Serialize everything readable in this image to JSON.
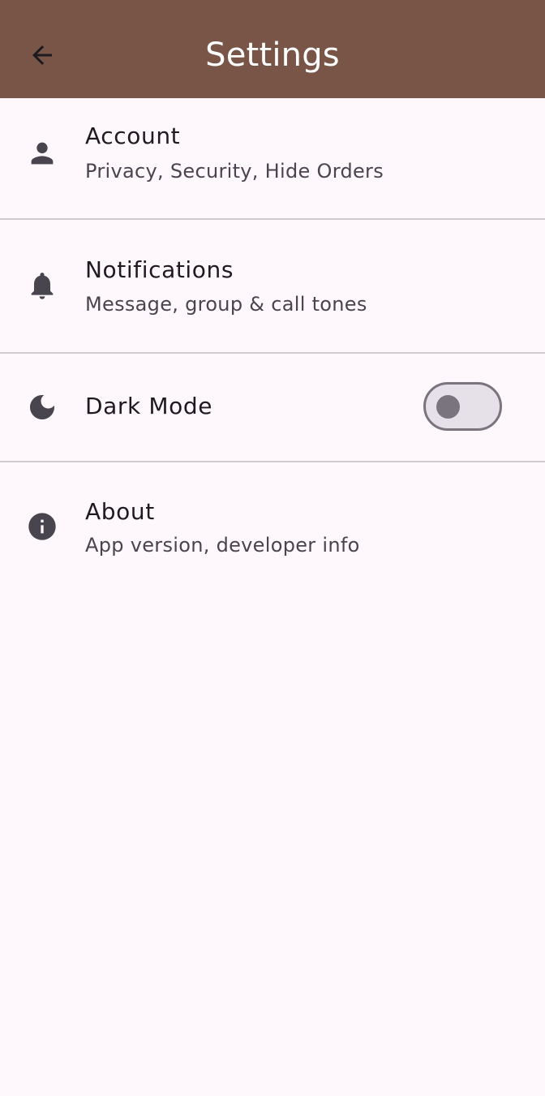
{
  "app_bar": {
    "title": "Settings",
    "background_color": "#795548",
    "back_icon": "arrow-left-icon"
  },
  "settings": {
    "account": {
      "icon": "person-icon",
      "title": "Account",
      "subtitle": "Privacy, Security, Hide Orders"
    },
    "notifications": {
      "icon": "bell-icon",
      "title": "Notifications",
      "subtitle": "Message, group & call tones"
    },
    "dark_mode": {
      "icon": "moon-icon",
      "title": "Dark Mode",
      "toggle_state": "off"
    },
    "about": {
      "icon": "info-icon",
      "title": "About",
      "subtitle": "App version, developer info"
    }
  },
  "colors": {
    "background": "#FEF7FC",
    "divider": "#CFCBD0",
    "icon": "#49454F",
    "toggle_track": "#E6E0E9",
    "toggle_outline": "#79747E"
  }
}
